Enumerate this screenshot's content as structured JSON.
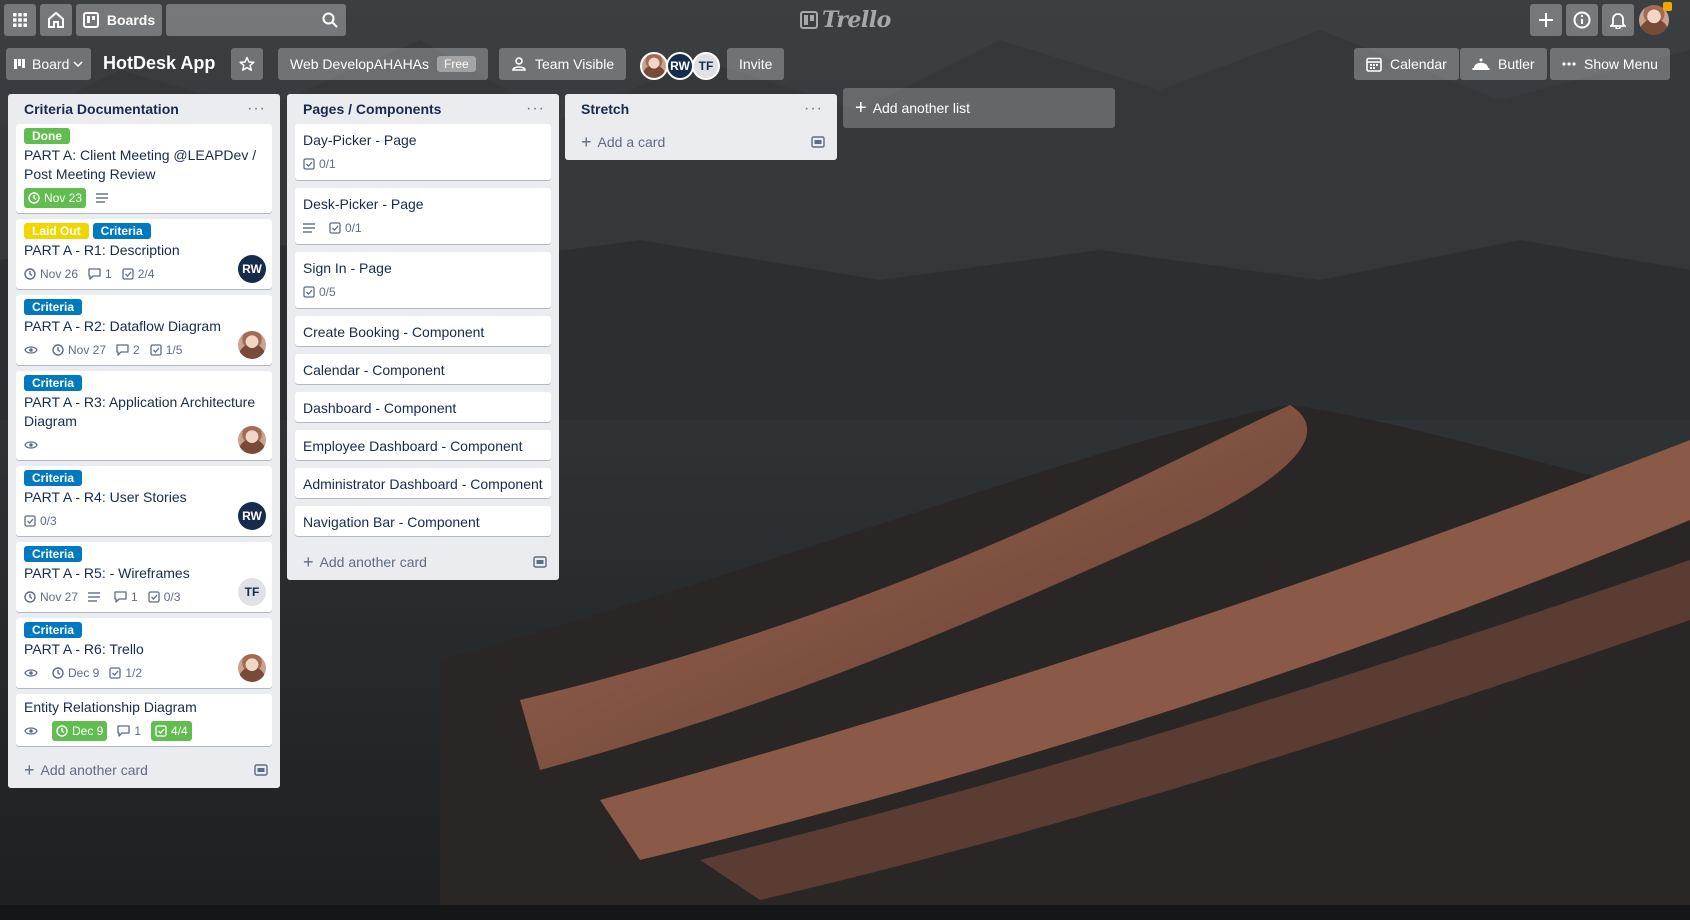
{
  "header": {
    "boards_label": "Boards",
    "search_placeholder": "",
    "logo_text": "Trello"
  },
  "board": {
    "view_label": "Board",
    "title": "HotDesk App",
    "workspace_label": "Web DevelopAHAHAs",
    "workspace_badge": "Free",
    "visibility_label": "Team Visible",
    "members": [
      "RW",
      "TF"
    ],
    "invite_label": "Invite",
    "calendar_label": "Calendar",
    "butler_label": "Butler",
    "show_menu_label": "Show Menu"
  },
  "lists": [
    {
      "title": "Criteria Documentation",
      "add_label": "Add another card",
      "cards": [
        {
          "labels": [
            {
              "text": "Done",
              "color": "green"
            }
          ],
          "title": "PART A: Client Meeting @LEAPDev / Post Meeting Review",
          "badges": {
            "due": "Nov 23",
            "due_done": true,
            "description": true
          }
        },
        {
          "labels": [
            {
              "text": "Laid Out",
              "color": "yellow"
            },
            {
              "text": "Criteria",
              "color": "blue"
            }
          ],
          "title": "PART A - R1: Description",
          "badges": {
            "due": "Nov 26",
            "comments": "1",
            "checklist": "2/4"
          },
          "member": "RW"
        },
        {
          "labels": [
            {
              "text": "Criteria",
              "color": "blue"
            }
          ],
          "title": "PART A - R2: Dataflow Diagram",
          "badges": {
            "watch": true,
            "due": "Nov 27",
            "comments": "2",
            "checklist": "1/5"
          },
          "member": "photo"
        },
        {
          "labels": [
            {
              "text": "Criteria",
              "color": "blue"
            }
          ],
          "title": "PART A - R3: Application Architecture Diagram",
          "badges": {
            "watch": true
          },
          "member": "photo"
        },
        {
          "labels": [
            {
              "text": "Criteria",
              "color": "blue"
            }
          ],
          "title": "PART A - R4: User Stories",
          "badges": {
            "checklist": "0/3"
          },
          "member": "RW"
        },
        {
          "labels": [
            {
              "text": "Criteria",
              "color": "blue"
            }
          ],
          "title": "PART A - R5: - Wireframes",
          "badges": {
            "due": "Nov 27",
            "description": true,
            "comments": "1",
            "checklist": "0/3"
          },
          "member": "TF"
        },
        {
          "labels": [
            {
              "text": "Criteria",
              "color": "blue"
            }
          ],
          "title": "PART A - R6: Trello",
          "badges": {
            "watch": true,
            "due": "Dec 9",
            "checklist": "1/2"
          },
          "member": "photo"
        },
        {
          "labels": [],
          "title": "Entity Relationship Diagram",
          "badges": {
            "watch": true,
            "due": "Dec 9",
            "due_done": true,
            "comments": "1",
            "checklist": "4/4",
            "checklist_done": true
          }
        }
      ]
    },
    {
      "title": "Pages / Components",
      "add_label": "Add another card",
      "cards": [
        {
          "labels": [],
          "title": "Day-Picker - Page",
          "badges": {
            "checklist": "0/1"
          }
        },
        {
          "labels": [],
          "title": "Desk-Picker - Page",
          "badges": {
            "description": true,
            "checklist": "0/1"
          }
        },
        {
          "labels": [],
          "title": "Sign In - Page",
          "badges": {
            "checklist": "0/5"
          }
        },
        {
          "labels": [],
          "title": "Create Booking - Component",
          "badges": {}
        },
        {
          "labels": [],
          "title": "Calendar - Component",
          "badges": {}
        },
        {
          "labels": [],
          "title": "Dashboard - Component",
          "badges": {}
        },
        {
          "labels": [],
          "title": "Employee Dashboard - Component",
          "badges": {}
        },
        {
          "labels": [],
          "title": "Administrator Dashboard - Component",
          "badges": {}
        },
        {
          "labels": [],
          "title": "Navigation Bar - Component",
          "badges": {}
        }
      ]
    },
    {
      "title": "Stretch",
      "add_label": "Add a card",
      "cards": []
    }
  ],
  "add_list_label": "Add another list",
  "colors": {
    "green": "#61bd4f",
    "yellow": "#f2d600",
    "blue": "#0079bf",
    "list_bg": "#ebecf0",
    "avatar_rw": "#172b4d",
    "avatar_tf": "#dfe1e6"
  }
}
